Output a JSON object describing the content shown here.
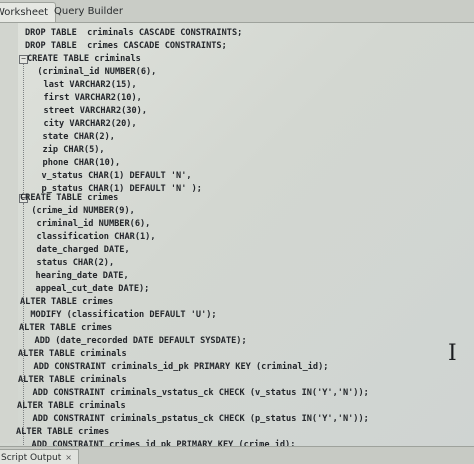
{
  "tabs": {
    "worksheet": "Worksheet",
    "query_builder": "Query Builder"
  },
  "editor": {
    "lines": [
      "DROP TABLE  criminals CASCADE CONSTRAINTS;",
      "DROP TABLE  crimes CASCADE CONSTRAINTS;",
      "CREATE TABLE criminals",
      "  (criminal_id NUMBER(6),",
      "   last VARCHAR2(15),",
      "   first VARCHAR2(10),",
      "   street VARCHAR2(30),",
      "   city VARCHAR2(20),",
      "   state CHAR(2),",
      "   zip CHAR(5),",
      "   phone CHAR(10),",
      "   v_status CHAR(1) DEFAULT 'N',",
      "   p_status CHAR(1) DEFAULT 'N' );",
      "CREATE TABLE crimes",
      "  (crime_id NUMBER(9),",
      "   criminal_id NUMBER(6),",
      "   classification CHAR(1),",
      "   date_charged DATE,",
      "   status CHAR(2),",
      "   hearing_date DATE,",
      "   appeal_cut_date DATE);",
      "ALTER TABLE crimes",
      "  MODIFY (classification DEFAULT 'U');",
      "ALTER TABLE crimes",
      "   ADD (date_recorded DATE DEFAULT SYSDATE);",
      "ALTER TABLE criminals",
      "   ADD CONSTRAINT criminals_id_pk PRIMARY KEY (criminal_id);",
      "ALTER TABLE criminals",
      "   ADD CONSTRAINT criminals_vstatus_ck CHECK (v_status IN('Y','N'));",
      "ALTER TABLE criminals",
      "   ADD CONSTRAINT criminals_pstatus_ck CHECK (p_status IN('Y','N'));",
      "ALTER TABLE crimes",
      "   ADD CONSTRAINT crimes_id_pk PRIMARY KEY (crime_id);"
    ]
  },
  "output_panel": {
    "tab_label": "Script Output",
    "close_glyph": "×"
  },
  "icons": {
    "fold": "minus-fold-icon",
    "cursor": "text-cursor-icon"
  }
}
